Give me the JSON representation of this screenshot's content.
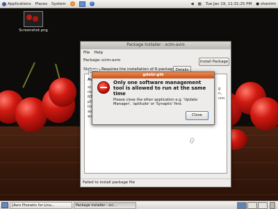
{
  "top_panel": {
    "menus": [
      "Applications",
      "Places",
      "System"
    ],
    "datetime": "Tue Jan 19, 11:31:25 PM",
    "user": "shamim"
  },
  "desktop": {
    "icon_label": "Screenshot.png"
  },
  "installer": {
    "title": "Package Installer - scim-avro",
    "menu": [
      "File",
      "Help"
    ],
    "package_label": "Package:",
    "package_value": "scim-avro",
    "install_button": "Install Package",
    "status_label": "Status:",
    "status_value": "Requires the installation of 6 packages",
    "details_button": "Details",
    "tab_label": "Desc",
    "status_bar": "Failed to install package file"
  },
  "dialog": {
    "title": "gdebi-gtk",
    "heading": "Only one software management tool is allowed to run at the same time",
    "message": "Please close the other application e.g. 'Update Manager', 'aptitude' or 'Synaptic' first.",
    "close_button": "Close"
  },
  "taskbar": {
    "items": [
      "[Avro Phonetic for Linu...",
      "Package installer - sci..."
    ]
  }
}
